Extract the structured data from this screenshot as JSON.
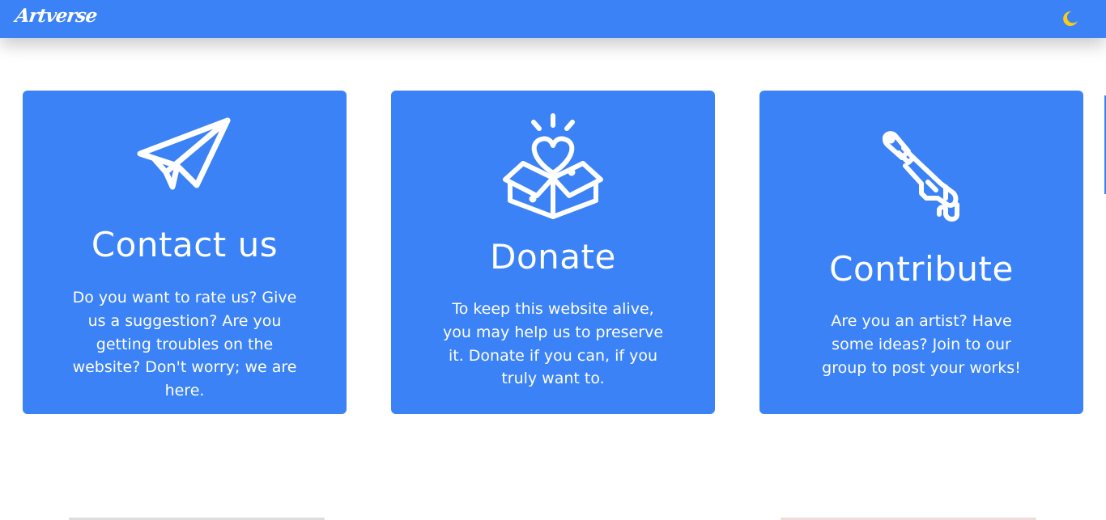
{
  "navbar": {
    "brand": "Artverse",
    "theme_toggle_icon": "moon-icon",
    "accent_color": "#3b82f6",
    "moon_color": "#facc15"
  },
  "cards": [
    {
      "icon": "paper-plane-icon",
      "title": "Contact us",
      "description": "Do you want to rate us? Give us a suggestion? Are you getting troubles on the website? Don't worry; we are here."
    },
    {
      "icon": "heart-box-icon",
      "title": "Donate",
      "description": "To keep this website alive, you may help us to preserve it. Donate if you can, if you truly want to."
    },
    {
      "icon": "paint-brush-icon",
      "title": "Contribute",
      "description": "Are you an artist? Have some ideas? Join to our group to post your works!"
    }
  ]
}
